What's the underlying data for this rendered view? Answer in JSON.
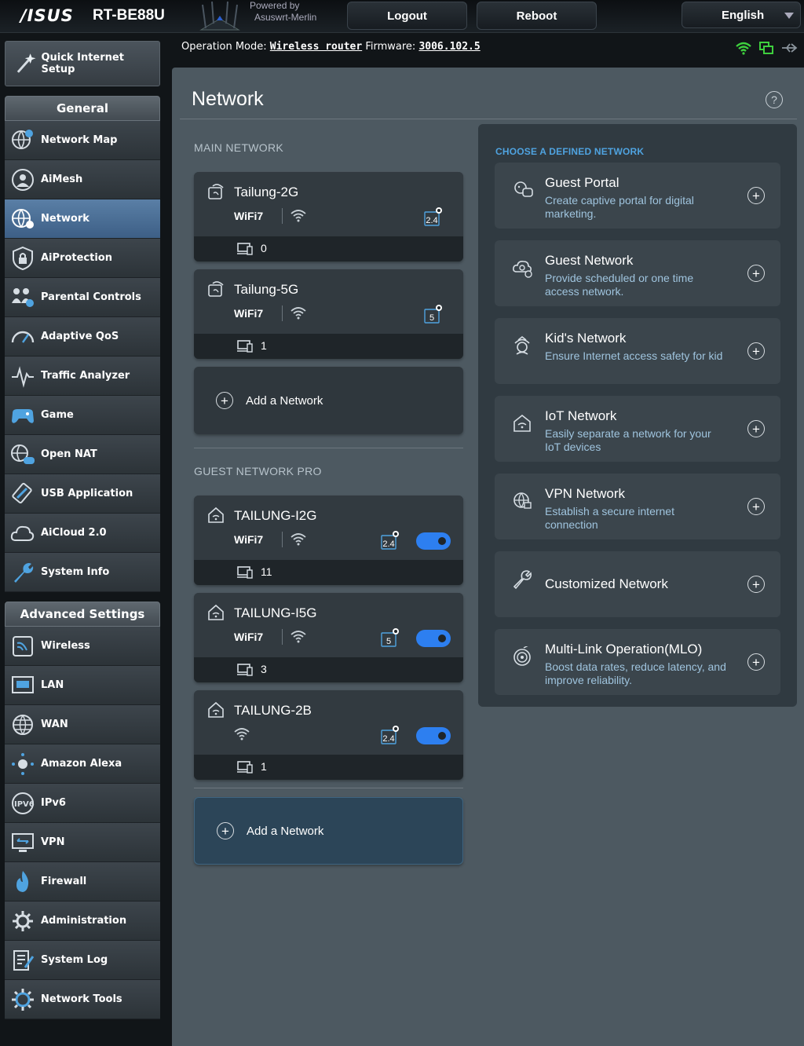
{
  "header": {
    "brand": "/ISUS",
    "model": "RT-BE88U",
    "powered_by": "Powered by",
    "firmware_vendor": "Asuswrt-Merlin",
    "logout": "Logout",
    "reboot": "Reboot",
    "language": "English"
  },
  "opmode": {
    "label": "Operation Mode:",
    "mode": "Wireless router",
    "fw_label": "Firmware:",
    "fw_version": "3006.102.5"
  },
  "sidebar": {
    "quick_setup": "Quick Internet Setup",
    "general_title": "General",
    "general": [
      {
        "label": "Network Map",
        "icon": "globe-map-icon"
      },
      {
        "label": "AiMesh",
        "icon": "mesh-icon"
      },
      {
        "label": "Network",
        "icon": "network-globe-icon",
        "active": true
      },
      {
        "label": "AiProtection",
        "icon": "shield-lock-icon"
      },
      {
        "label": "Parental Controls",
        "icon": "family-icon"
      },
      {
        "label": "Adaptive QoS",
        "icon": "speedometer-icon"
      },
      {
        "label": "Traffic Analyzer",
        "icon": "pulse-icon"
      },
      {
        "label": "Game",
        "icon": "gamepad-icon"
      },
      {
        "label": "Open NAT",
        "icon": "globe-gamepad-icon"
      },
      {
        "label": "USB Application",
        "icon": "usb-icon"
      },
      {
        "label": "AiCloud 2.0",
        "icon": "cloud-icon"
      },
      {
        "label": "System Info",
        "icon": "wrench-icon"
      }
    ],
    "advanced_title": "Advanced Settings",
    "advanced": [
      {
        "label": "Wireless",
        "icon": "wireless-icon"
      },
      {
        "label": "LAN",
        "icon": "lan-icon"
      },
      {
        "label": "WAN",
        "icon": "wan-globe-icon"
      },
      {
        "label": "Amazon Alexa",
        "icon": "alexa-icon"
      },
      {
        "label": "IPv6",
        "icon": "ipv6-icon"
      },
      {
        "label": "VPN",
        "icon": "vpn-icon"
      },
      {
        "label": "Firewall",
        "icon": "firewall-icon"
      },
      {
        "label": "Administration",
        "icon": "admin-gear-icon"
      },
      {
        "label": "System Log",
        "icon": "log-icon"
      },
      {
        "label": "Network Tools",
        "icon": "tools-gear-icon"
      }
    ]
  },
  "main": {
    "title": "Network",
    "help": "?",
    "main_network_label": "MAIN NETWORK",
    "main_networks": [
      {
        "ssid": "Tailung-2G",
        "wifi": "WiFi7",
        "band": "2.4",
        "clients": "0"
      },
      {
        "ssid": "Tailung-5G",
        "wifi": "WiFi7",
        "band": "5",
        "clients": "1"
      }
    ],
    "add_network": "Add a Network",
    "guest_label": "GUEST NETWORK PRO",
    "guest_networks": [
      {
        "ssid": "TAILUNG-I2G",
        "wifi": "WiFi7",
        "band": "2.4",
        "clients": "11",
        "enabled": true
      },
      {
        "ssid": "TAILUNG-I5G",
        "wifi": "WiFi7",
        "band": "5",
        "clients": "3",
        "enabled": true
      },
      {
        "ssid": "TAILUNG-2B",
        "wifi": "",
        "band": "2.4",
        "clients": "1",
        "enabled": true
      }
    ],
    "add_network_2": "Add a Network"
  },
  "defined": {
    "label": "CHOOSE A DEFINED NETWORK",
    "items": [
      {
        "title": "Guest Portal",
        "desc": "Create captive portal for digital marketing.",
        "icon": "portal-icon"
      },
      {
        "title": "Guest Network",
        "desc": "Provide scheduled or one time access network.",
        "icon": "guest-cloud-icon"
      },
      {
        "title": "Kid's Network",
        "desc": "Ensure Internet access safety for kid",
        "icon": "kid-icon"
      },
      {
        "title": "IoT Network",
        "desc": "Easily separate a network for your IoT devices",
        "icon": "iot-house-icon"
      },
      {
        "title": "VPN Network",
        "desc": "Establish a secure internet connection",
        "icon": "vpn-globe-icon"
      },
      {
        "title": "Customized Network",
        "desc": "",
        "icon": "wrench-icon"
      },
      {
        "title": "Multi-Link Operation(MLO)",
        "desc": "Boost data rates, reduce latency, and improve reliability.",
        "icon": "mlo-icon"
      }
    ]
  },
  "colors": {
    "accent": "#4fa3e0",
    "toggle": "#2d7ff0",
    "active_menu": "#4a6f96"
  }
}
